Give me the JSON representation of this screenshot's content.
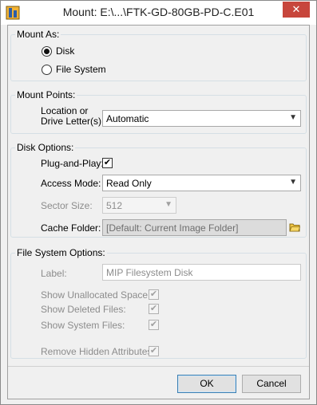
{
  "window": {
    "title": "Mount: E:\\...\\FTK-GD-80GB-PD-C.E01",
    "close_label": "✕"
  },
  "mount_as": {
    "legend": "Mount As:",
    "options": [
      {
        "label": "Disk",
        "checked": true
      },
      {
        "label": "File System",
        "checked": false
      }
    ]
  },
  "mount_points": {
    "legend": "Mount Points:",
    "location_label_line1": "Location or",
    "location_label_line2": "Drive Letter(s):",
    "location_value": "Automatic"
  },
  "disk_options": {
    "legend": "Disk Options:",
    "plug_and_play_label": "Plug-and-Play:",
    "plug_and_play_checked": true,
    "access_mode_label": "Access Mode:",
    "access_mode_value": "Read Only",
    "sector_size_label": "Sector Size:",
    "sector_size_value": "512",
    "cache_folder_label": "Cache Folder:",
    "cache_folder_value": "[Default: Current Image Folder]"
  },
  "fs_options": {
    "legend": "File System Options:",
    "label_label": "Label:",
    "label_value": "MIP Filesystem Disk",
    "show_unallocated_label": "Show Unallocated Space:",
    "show_deleted_label": "Show Deleted Files:",
    "show_system_label": "Show System Files:",
    "remove_hidden_label": "Remove Hidden Attributes:"
  },
  "buttons": {
    "ok": "OK",
    "cancel": "Cancel"
  },
  "icons": {
    "app": "app-icon",
    "folder": "folder-icon",
    "close": "close-icon",
    "dropdown": "chevron-down-icon"
  }
}
